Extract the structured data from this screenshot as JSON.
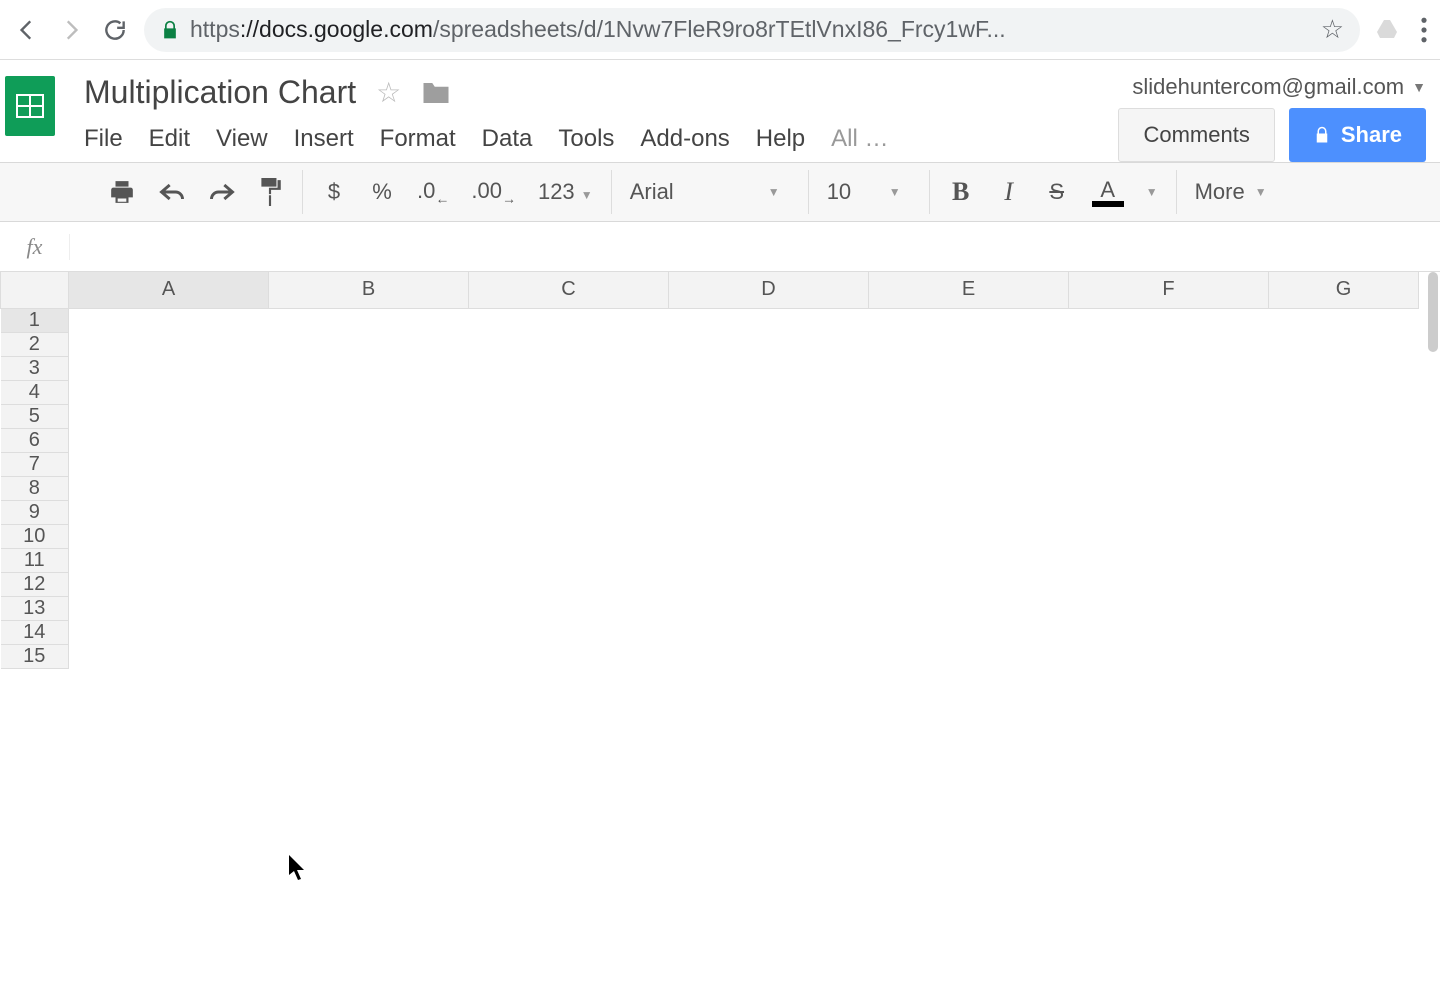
{
  "browser": {
    "url_scheme": "https",
    "url_host": "://docs.google.com",
    "url_path": "/spreadsheets/d/1Nvw7FleR9ro8rTEtlVnxI86_Frcy1wF..."
  },
  "document": {
    "title": "Multiplication Chart",
    "user_email": "slidehuntercom@gmail.com",
    "comments_label": "Comments",
    "share_label": "Share"
  },
  "menu": {
    "items": [
      "File",
      "Edit",
      "View",
      "Insert",
      "Format",
      "Data",
      "Tools",
      "Add-ons",
      "Help"
    ],
    "overflow": "All …"
  },
  "toolbar": {
    "currency": "$",
    "percent": "%",
    "dec_less": ".0",
    "dec_more": ".00",
    "number_format": "123",
    "font_name": "Arial",
    "font_size": "10",
    "bold": "B",
    "italic": "I",
    "strike": "S",
    "text_color_letter": "A",
    "more_label": "More"
  },
  "formula_bar": {
    "fx": "fx",
    "value": ""
  },
  "grid": {
    "columns": [
      "A",
      "B",
      "C",
      "D",
      "E",
      "F",
      "G"
    ],
    "rows": [
      "1",
      "2",
      "3",
      "4",
      "5",
      "6",
      "7",
      "8",
      "9",
      "10",
      "11",
      "12",
      "13",
      "14",
      "15"
    ],
    "selected_cell": "A1"
  }
}
